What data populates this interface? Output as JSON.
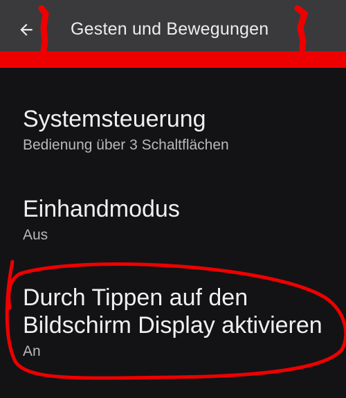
{
  "appbar": {
    "title": "Gesten und Bewegungen",
    "back_icon": "arrow-left-icon"
  },
  "settings": [
    {
      "title": "Systemsteuerung",
      "subtitle": "Bedienung über 3 Schaltflächen"
    },
    {
      "title": "Einhandmodus",
      "subtitle": "Aus"
    },
    {
      "title": "Durch Tippen auf den Bildschirm Display aktivieren",
      "subtitle": "An"
    }
  ],
  "colors": {
    "background": "#131315",
    "appbar": "#3a3a3c",
    "annotation": "#ee0000"
  }
}
